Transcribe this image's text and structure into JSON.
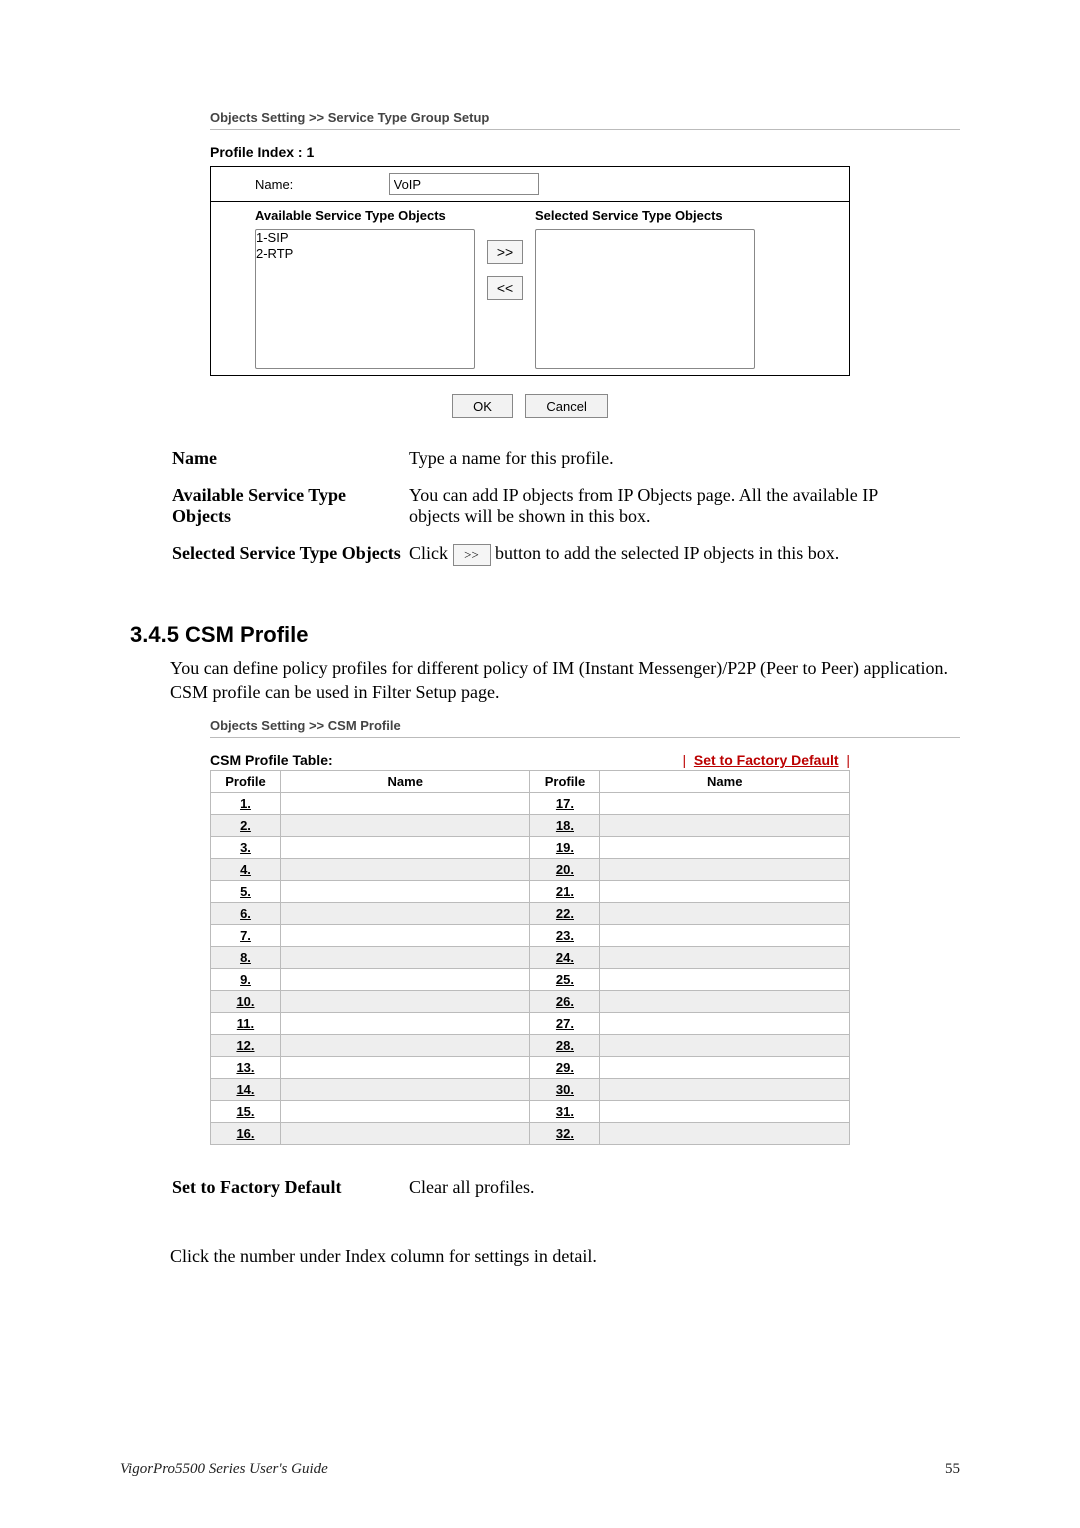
{
  "group_setup": {
    "breadcrumb": "Objects Setting >> Service Type Group Setup",
    "profile_index": "Profile Index : 1",
    "name_label": "Name:",
    "name_value": "VoIP",
    "avail_head": "Available Service Type Objects",
    "sel_head": "Selected Service Type Objects",
    "opt1": "1-SIP",
    "opt2": "2-RTP",
    "arrow_r": ">>",
    "arrow_l": "<<",
    "ok": "OK",
    "cancel": "Cancel"
  },
  "desc": {
    "name_l": "Name",
    "name_r": "Type a name for this profile.",
    "avail_l": "Available Service Type Objects",
    "avail_r": "You can add IP objects from IP Objects page. All the available IP objects will be shown in this box.",
    "sel_l": "Selected Service Type Objects",
    "sel_r_pre": "Click ",
    "sel_btn": ">>",
    "sel_r_post": " button to add the selected IP objects in this box."
  },
  "section": {
    "heading": "3.4.5 CSM Profile",
    "body": "You can define policy profiles for different policy of IM (Instant Messenger)/P2P (Peer to Peer) application. CSM profile can be used in Filter Setup page."
  },
  "csm": {
    "breadcrumb": "Objects Setting >> CSM Profile",
    "table_label": "CSM Profile Table:",
    "factory": "Set to Factory Default",
    "col_profile": "Profile",
    "col_name": "Name",
    "left": [
      "1.",
      "2.",
      "3.",
      "4.",
      "5.",
      "6.",
      "7.",
      "8.",
      "9.",
      "10.",
      "11.",
      "12.",
      "13.",
      "14.",
      "15.",
      "16."
    ],
    "right": [
      "17.",
      "18.",
      "19.",
      "20.",
      "21.",
      "22.",
      "23.",
      "24.",
      "25.",
      "26.",
      "27.",
      "28.",
      "29.",
      "30.",
      "31.",
      "32."
    ],
    "desc_l": "Set to Factory Default",
    "desc_r": "Clear all profiles.",
    "click_txt": "Click the number under Index column for settings in detail."
  },
  "footer": {
    "left": "VigorPro5500 Series User's Guide",
    "right": "55"
  }
}
